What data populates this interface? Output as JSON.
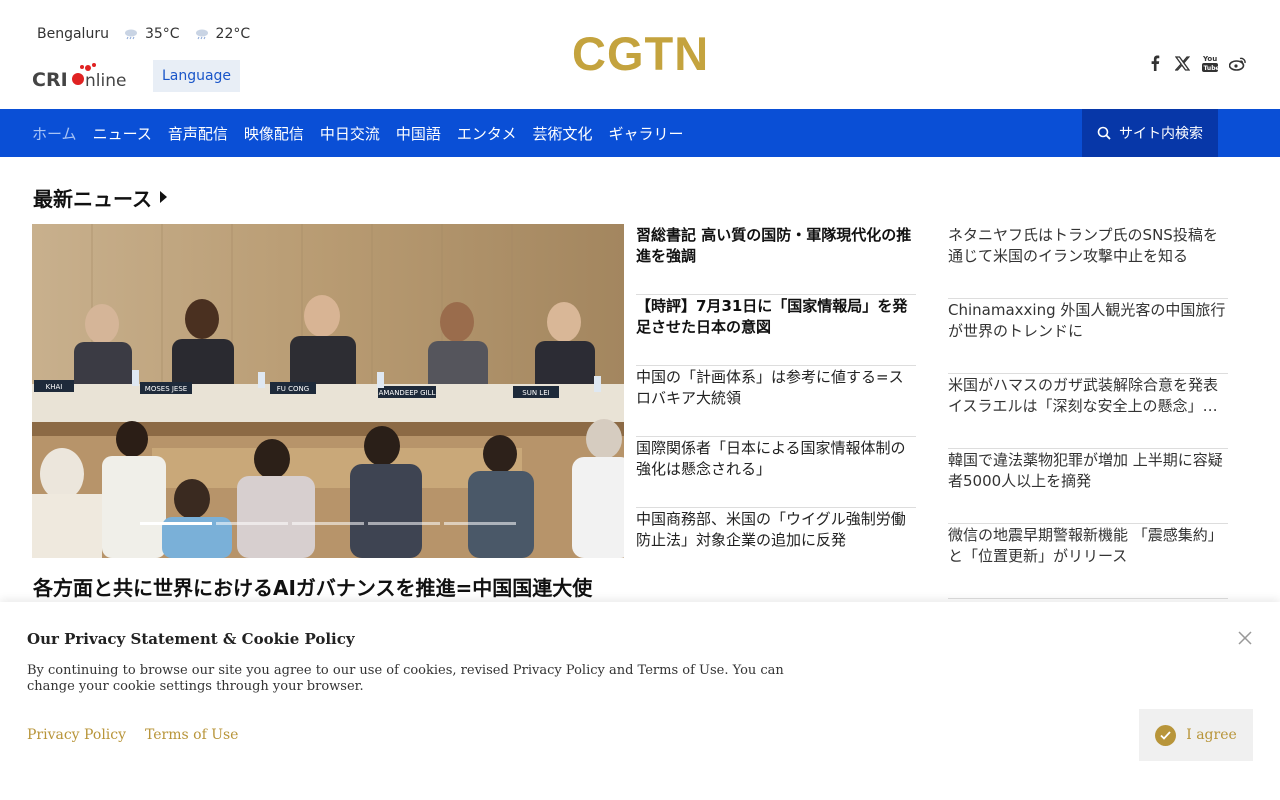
{
  "header": {
    "weather": {
      "city": "Bengaluru",
      "temp_high": "35°C",
      "temp_low": "22°C",
      "icon": "cloud-rain-icon"
    },
    "cri_logo_text": "CRIonline",
    "language_button": "Language",
    "logo": "CGTN",
    "social": [
      "facebook-icon",
      "x-icon",
      "youtube-icon",
      "weibo-icon"
    ]
  },
  "nav": {
    "items": [
      "ホーム",
      "ニュース",
      "音声配信",
      "映像配信",
      "中日交流",
      "中国語",
      "エンタメ",
      "芸術文化",
      "ギャラリー"
    ],
    "active_index": 0,
    "search_label": "サイト内検索"
  },
  "section": {
    "title": "最新ニュース"
  },
  "hero": {
    "caption": "各方面と共に世界におけるAIガバナンスを推進=中国国連大使",
    "nameplates": [
      "KHAI",
      "MOSES JESE",
      "FU CONG",
      "AMANDEEP GILL",
      "SUN LEI"
    ],
    "slide_count": 5,
    "active_slide": 0
  },
  "middle_news": [
    {
      "title": "習総書記 高い質の国防・軍隊現代化の推進を強調",
      "bold": true
    },
    {
      "title": "【時評】7月31日に「国家情報局」を発足させた日本の意図",
      "bold": true
    },
    {
      "title": "中国の「計画体系」は参考に値する=スロバキア大統領",
      "bold": false
    },
    {
      "title": "国際関係者「日本による国家情報体制の強化は懸念される」",
      "bold": false
    },
    {
      "title": "中国商務部、米国の「ウイグル強制労働防止法」対象企業の追加に反発",
      "bold": false
    }
  ],
  "right_news": [
    "ネタニヤフ氏はトランプ氏のSNS投稿を通じて米国のイラン攻撃中止を知る",
    "Chinamaxxing 外国人観光客の中国旅行が世界のトレンドに",
    "米国がハマスのガザ武装解除合意を発表 イスラエルは「深刻な安全上の懸念」を表明",
    "韓国で違法薬物犯罪が増加 上半期に容疑者5000人以上を摘発",
    "微信の地震早期警報新機能 「震感集約」と「位置更新」がリリース"
  ],
  "cookie": {
    "title": "Our Privacy Statement & Cookie Policy",
    "text": "By continuing to browse our site you agree to our use of cookies, revised Privacy Policy and Terms of Use. You can change your cookie settings through your browser.",
    "privacy_link": "Privacy Policy",
    "terms_link": "Terms of Use",
    "agree_label": "I agree"
  },
  "colors": {
    "nav_blue": "#0a4fd6",
    "search_blue": "#0737a8",
    "gold": "#c4a33e",
    "cookie_gold": "#b8953a"
  }
}
